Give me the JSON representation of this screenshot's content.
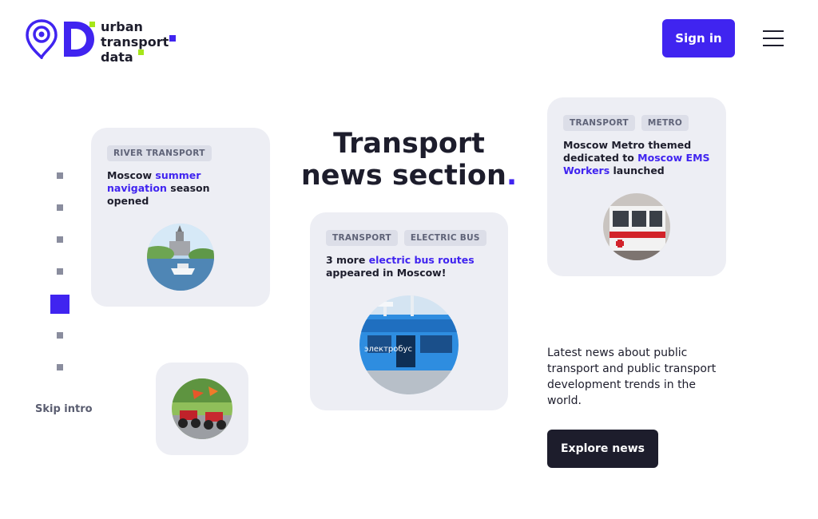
{
  "header": {
    "logo_lines": [
      "urban",
      "transport",
      "data"
    ],
    "signin_label": "Sign in",
    "brand_color": "#4024f0",
    "accent_green": "#a6e61a"
  },
  "intro": {
    "skip_label": "Skip intro",
    "dot_count": 7,
    "active_dot": 5
  },
  "headline": {
    "line1": "Transport",
    "line2": "news section",
    "dot": "."
  },
  "cards": {
    "river": {
      "tags": [
        "RIVER TRANSPORT"
      ],
      "title_pre": "Moscow ",
      "title_hl": "summer navigation",
      "title_post": " season opened"
    },
    "bus": {
      "tags": [
        "TRANSPORT",
        "ELECTRIC BUS"
      ],
      "title_pre": "3 more ",
      "title_hl": "electric bus routes",
      "title_post": " appeared in Moscow!",
      "image_text": "электробус"
    },
    "metro": {
      "tags": [
        "TRANSPORT",
        "METRO"
      ],
      "title_pre": "Moscow Metro themed dedicated to ",
      "title_hl": "Moscow EMS Workers",
      "title_post": " launched"
    }
  },
  "sidebar_text": {
    "description": "Latest news about public transport and public transport development trends in the world.",
    "explore_label": "Explore news"
  }
}
